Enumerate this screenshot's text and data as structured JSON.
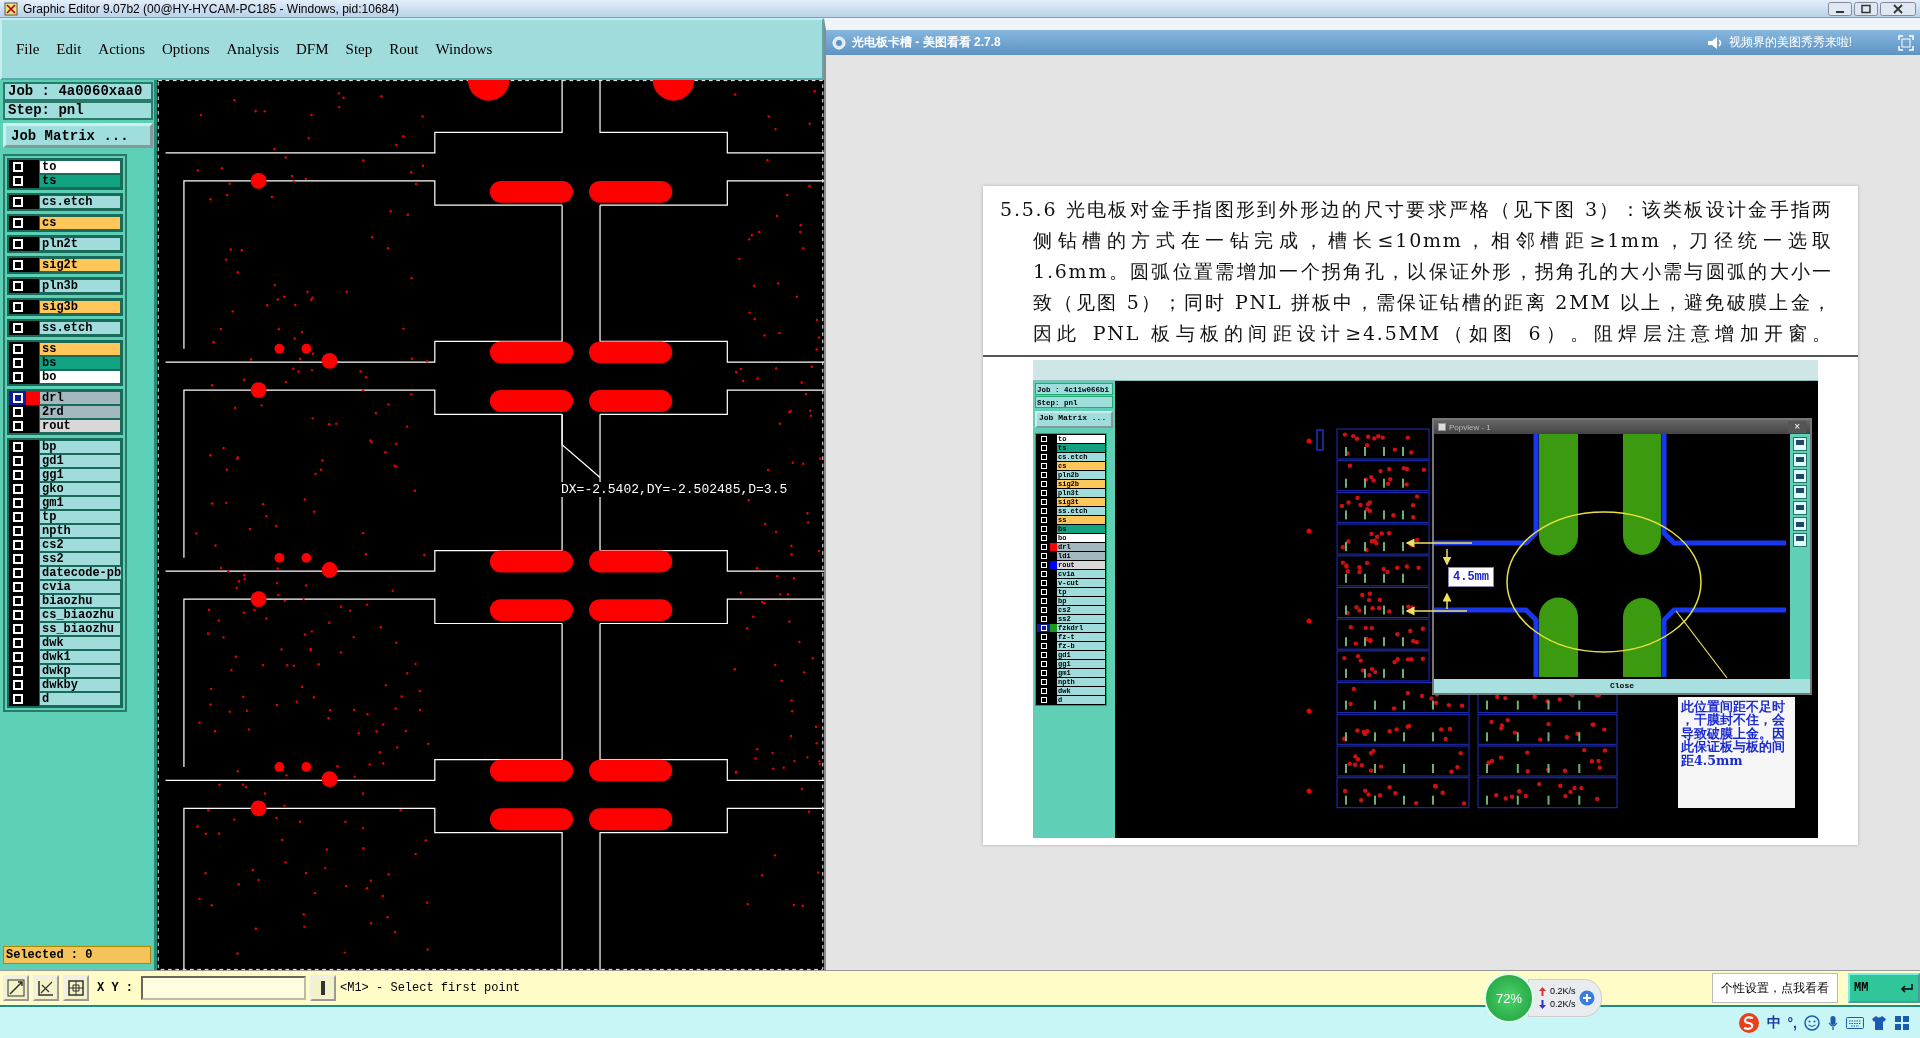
{
  "title_bar": {
    "title": "Graphic Editor 9.07b2 (00@HY-HYCAM-PC185 - Windows, pid:10684)"
  },
  "menu": [
    "File",
    "Edit",
    "Actions",
    "Options",
    "Analysis",
    "DFM",
    "Step",
    "Rout",
    "Windows"
  ],
  "job": {
    "job": "Job : 4a0060xaa0",
    "step": "Step: pnl",
    "matrix_button": "Job Matrix ..."
  },
  "layer_groups": [
    {
      "layers": [
        {
          "name": "to",
          "color": "#ffffff",
          "affected": false
        },
        {
          "name": "ts",
          "color": "#11a381",
          "affected": false
        }
      ]
    },
    {
      "layers": [
        {
          "name": "cs.etch",
          "color": "#a0dcdc",
          "affected": false
        }
      ]
    },
    {
      "layers": [
        {
          "name": "cs",
          "color": "#ffc65a",
          "affected": false
        }
      ]
    },
    {
      "layers": [
        {
          "name": "pln2t",
          "color": "#a0dcdc",
          "affected": false
        }
      ]
    },
    {
      "layers": [
        {
          "name": "sig2t",
          "color": "#ffc65a",
          "affected": false
        }
      ]
    },
    {
      "layers": [
        {
          "name": "pln3b",
          "color": "#a0dcdc",
          "affected": false
        }
      ]
    },
    {
      "layers": [
        {
          "name": "sig3b",
          "color": "#ffc65a",
          "affected": false
        }
      ]
    },
    {
      "layers": [
        {
          "name": "ss.etch",
          "color": "#a0dcdc",
          "affected": false
        }
      ]
    },
    {
      "layers": [
        {
          "name": "ss",
          "color": "#ffc65a",
          "affected": false
        },
        {
          "name": "bs",
          "color": "#11a381",
          "affected": false
        },
        {
          "name": "bo",
          "color": "#ffffff",
          "affected": false
        }
      ]
    },
    {
      "layers": [
        {
          "name": "drl",
          "color": "#a3b8bf",
          "affected": true,
          "swatch": {
            "color": "#ff0000"
          }
        },
        {
          "name": "2rd",
          "color": "#a3b8bf",
          "affected": false
        },
        {
          "name": "rout",
          "color": "#d8d8d8",
          "affected": false
        }
      ]
    },
    {
      "layers": [
        {
          "name": "bp",
          "color": "#a0dcdc",
          "affected": false
        },
        {
          "name": "gd1",
          "color": "#a0dcdc",
          "affected": false
        },
        {
          "name": "gg1",
          "color": "#a0dcdc",
          "affected": false
        },
        {
          "name": "gko",
          "color": "#a0dcdc",
          "affected": false
        },
        {
          "name": "gm1",
          "color": "#a0dcdc",
          "affected": false
        },
        {
          "name": "tp",
          "color": "#a0dcdc",
          "affected": false
        },
        {
          "name": "npth",
          "color": "#a0dcdc",
          "affected": false
        },
        {
          "name": "cs2",
          "color": "#a0dcdc",
          "affected": false
        },
        {
          "name": "ss2",
          "color": "#a0dcdc",
          "affected": false
        },
        {
          "name": "datecode-pb",
          "color": "#a0dcdc",
          "affected": false
        },
        {
          "name": "cvia",
          "color": "#a0dcdc",
          "affected": false
        },
        {
          "name": "biaozhu",
          "color": "#a0dcdc",
          "affected": false
        },
        {
          "name": "cs_biaozhu",
          "color": "#a0dcdc",
          "affected": false
        },
        {
          "name": "ss_biaozhu",
          "color": "#a0dcdc",
          "affected": false
        },
        {
          "name": "dwk",
          "color": "#a0dcdc",
          "affected": false
        },
        {
          "name": "dwk1",
          "color": "#a0dcdc",
          "affected": false
        },
        {
          "name": "dwkp",
          "color": "#a0dcdc",
          "affected": false
        },
        {
          "name": "dwkby",
          "color": "#a0dcdc",
          "affected": false
        },
        {
          "name": "d",
          "color": "#a0dcdc",
          "affected": false
        }
      ]
    }
  ],
  "selected_count": "Selected : 0",
  "canvas": {
    "readout": "DX=-2.5402,DY=-2.502485,D=3.5"
  },
  "viewer": {
    "title": "光电板卡槽 - 美图看看 2.7.8",
    "promo": "视频界的美图秀秀来啦!"
  },
  "document": {
    "paragraph": "5.5.6 光电板对金手指图形到外形边的尺寸要求严格（见下图 3）：该类板设计金手指两侧钻槽的方式在一钻完成，槽长≤10mm，相邻槽距≥1mm，刀径统一选取 1.6mm。圆弧位置需增加一个拐角孔，以保证外形，拐角孔的大小需与圆弧的大小一致（见图 5）；同时 PNL 拼板中，需保证钻槽的距离 2MM 以上，避免破膜上金，因此 PNL 板与板的间距设计≥4.5MM（如图 6）。阻焊层注意增加开窗。",
    "figure": {
      "job": "Job : 4c11w066b1",
      "step": "Step: pnl",
      "matrix_button": "Job Matrix ...",
      "layers": [
        {
          "name": "to",
          "color": "#ffffff",
          "affected": false
        },
        {
          "name": "ts",
          "color": "#11a381",
          "affected": false
        },
        {
          "name": "cs.etch",
          "color": "#a0dcdc",
          "affected": false
        },
        {
          "name": "cs",
          "color": "#ffc65a",
          "affected": false
        },
        {
          "name": "pln2b",
          "color": "#a0dcdc",
          "affected": false
        },
        {
          "name": "sig2b",
          "color": "#ffc65a",
          "affected": false
        },
        {
          "name": "pln3t",
          "color": "#a0dcdc",
          "affected": false
        },
        {
          "name": "sig3t",
          "color": "#ffc65a",
          "affected": false
        },
        {
          "name": "ss.etch",
          "color": "#a0dcdc",
          "affected": false
        },
        {
          "name": "ss",
          "color": "#ffc65a",
          "affected": false
        },
        {
          "name": "bs",
          "color": "#11a381",
          "affected": false
        },
        {
          "name": "bo",
          "color": "#ffffff",
          "affected": false
        },
        {
          "name": "drl",
          "color": "#a3b8bf",
          "affected": false,
          "swatch": {
            "color": "#ff0000"
          }
        },
        {
          "name": "ldi",
          "color": "#a3b8bf",
          "affected": false
        },
        {
          "name": "rout",
          "color": "#d8d8d8",
          "affected": false,
          "swatch": {
            "color": "#0000ff"
          }
        },
        {
          "name": "cvia",
          "color": "#a0dcdc",
          "affected": false
        },
        {
          "name": "v-cut",
          "color": "#a0dcdc",
          "affected": false
        },
        {
          "name": "tp",
          "color": "#a0dcdc",
          "affected": false
        },
        {
          "name": "bp",
          "color": "#a0dcdc",
          "affected": false
        },
        {
          "name": "cs2",
          "color": "#a0dcdc",
          "affected": false
        },
        {
          "name": "ss2",
          "color": "#a0dcdc",
          "affected": false
        },
        {
          "name": "fzkdrl",
          "color": "#a0dcdc",
          "affected": true,
          "swatch": {
            "color": "#1a9a1a"
          }
        },
        {
          "name": "fz-t",
          "color": "#a0dcdc",
          "affected": false
        },
        {
          "name": "fz-b",
          "color": "#a0dcdc",
          "affected": false
        },
        {
          "name": "gd1",
          "color": "#a0dcdc",
          "affected": false
        },
        {
          "name": "gg1",
          "color": "#a0dcdc",
          "affected": false
        },
        {
          "name": "gm1",
          "color": "#a0dcdc",
          "affected": false
        },
        {
          "name": "npth",
          "color": "#a0dcdc",
          "affected": false
        },
        {
          "name": "dwk",
          "color": "#a0dcdc",
          "affected": false
        },
        {
          "name": "d",
          "color": "#a0dcdc",
          "affected": false
        }
      ],
      "popview_title": "Popview - 1",
      "popview_close_glyph": "×",
      "close_button": "Close",
      "dimension": "4.5mm",
      "note": "此位置间距不足时，干膜封不住，会导致破膜上金。因此保证板与板的间距4.5mm"
    }
  },
  "status": {
    "xy_label": "X Y :",
    "prompt": "<M1> - Select first point",
    "units": "MM"
  },
  "net_widget": {
    "percent": "72%",
    "up": "0.2K/s",
    "down": "0.2K/s"
  },
  "tooltip": "个性设置，点我看看",
  "tray": {
    "ime": "中",
    "punct": "°,"
  }
}
